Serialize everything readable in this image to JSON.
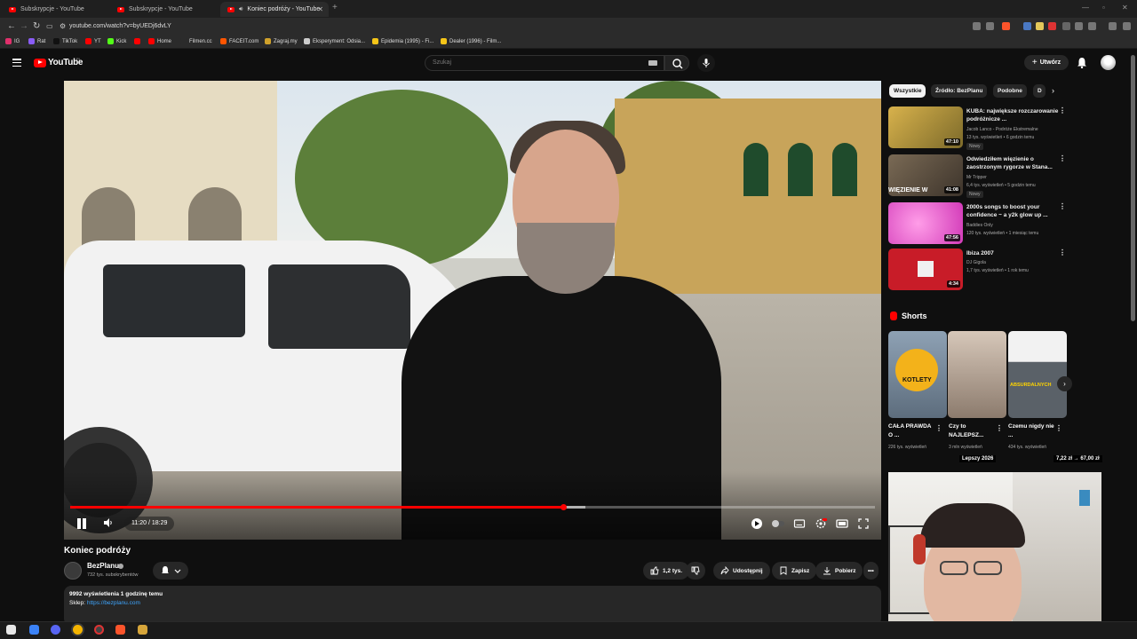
{
  "browser": {
    "tabs": [
      {
        "label": "Subskrypcje - YouTube",
        "active": false
      },
      {
        "label": "Subskrypcje - YouTube",
        "active": false
      },
      {
        "label": "Koniec podróży - YouTube",
        "active": true
      }
    ],
    "address": "youtube.com/watch?v=byUEDj6dvLY",
    "bookmarks": [
      {
        "label": "IG",
        "color": "#e1306c"
      },
      {
        "label": "Rat",
        "color": "#8a5cf6"
      },
      {
        "label": "TikTok",
        "color": "#111111"
      },
      {
        "label": "YT",
        "color": "#ff0000"
      },
      {
        "label": "Kick",
        "color": "#53fc18"
      },
      {
        "label": "Home",
        "color": "#ff0000"
      },
      {
        "label": "Filmen.cc",
        "color": "#2b2b2b"
      },
      {
        "label": "FACEIT.com",
        "color": "#ff5500"
      },
      {
        "label": "Zagraj.my",
        "color": "#cfa12b"
      },
      {
        "label": "Eksperyment: Odsia...",
        "color": "#cccccc"
      },
      {
        "label": "Epidemia (1995) - Fi...",
        "color": "#f5c518"
      },
      {
        "label": "Dealer (1996) - Film...",
        "color": "#f5c518"
      }
    ]
  },
  "header": {
    "logo_text": "YouTube",
    "region": "PL",
    "search_placeholder": "Szukaj",
    "create_label": "Utwórz"
  },
  "player": {
    "current_time": "11:20",
    "duration": "18:29",
    "time_display": "11:20 / 18:29",
    "played_fraction": 0.613,
    "buffered_fraction": 0.64
  },
  "video": {
    "title": "Koniec podróży",
    "channel": "BezPlanu",
    "subscribers": "732 tys. subskrybentów",
    "likes": "1,2 tys.",
    "share_label": "Udostępnij",
    "save_label": "Zapisz",
    "download_label": "Pobierz",
    "stats": "9992 wyświetlenia  1 godzinę temu",
    "shop_label": "Sklep:",
    "shop_link": "https://bezplanu.com"
  },
  "chips": [
    {
      "label": "Wszystkie",
      "active": true
    },
    {
      "label": "Źródło: BezPlanu",
      "active": false
    },
    {
      "label": "Podobne",
      "active": false
    },
    {
      "label": "D",
      "active": false
    }
  ],
  "recommendations": [
    {
      "title": "KUBA: największe rozczarowanie podróżnicze ...",
      "channel": "Jacob Lanco - Podróże Ekstremalne",
      "meta": "13 tys. wyświetleń • 6 godzin temu",
      "badge": "Nowy",
      "duration": "47:10",
      "thumb_color": "#c9a54a"
    },
    {
      "title": "Odwiedziłem więzienie o zaostrzonym rygorze w Stana...",
      "channel": "Mr Tripper",
      "meta": "6,4 tys. wyświetleń • 5 godzin temu",
      "badge": "Nowy",
      "duration": "41:08",
      "thumb_color": "#6b5a48",
      "thumb_text": "WIĘZIENIE W"
    },
    {
      "title": "2000s songs to boost your confidence ~ a y2k glow up ...",
      "channel": "Baddies Only",
      "meta": "120 tys. wyświetleń • 1 miesiąc temu",
      "badge": "",
      "duration": "47:56",
      "thumb_color": "#e24fc8"
    },
    {
      "title": "Ibiza 2007",
      "channel": "DJ Gigola",
      "meta": "1,7 tys. wyświetleń • 1 rok temu",
      "badge": "",
      "duration": "4:34",
      "thumb_color": "#d81e2a"
    }
  ],
  "shorts": {
    "title": "Shorts",
    "items": [
      {
        "title": "CAŁA PRAWDA O ...",
        "views": "226 tys. wyświetleń",
        "thumb_color": "#7d8ea0",
        "overlay": "KOTLETY"
      },
      {
        "title": "Czy to NAJLEPSZ...",
        "views": "3 mln wyświetleń",
        "thumb_color": "#b9a79a",
        "overlay": ""
      },
      {
        "title": "Czemu nigdy nie ...",
        "views": "434 tys. wyświetleń",
        "thumb_color": "#8b949b",
        "overlay": "ABSURDALNYCH"
      }
    ],
    "overlay_left": "Lepszy 2026",
    "overlay_right": "7,22 zł → 67,00 zł"
  }
}
